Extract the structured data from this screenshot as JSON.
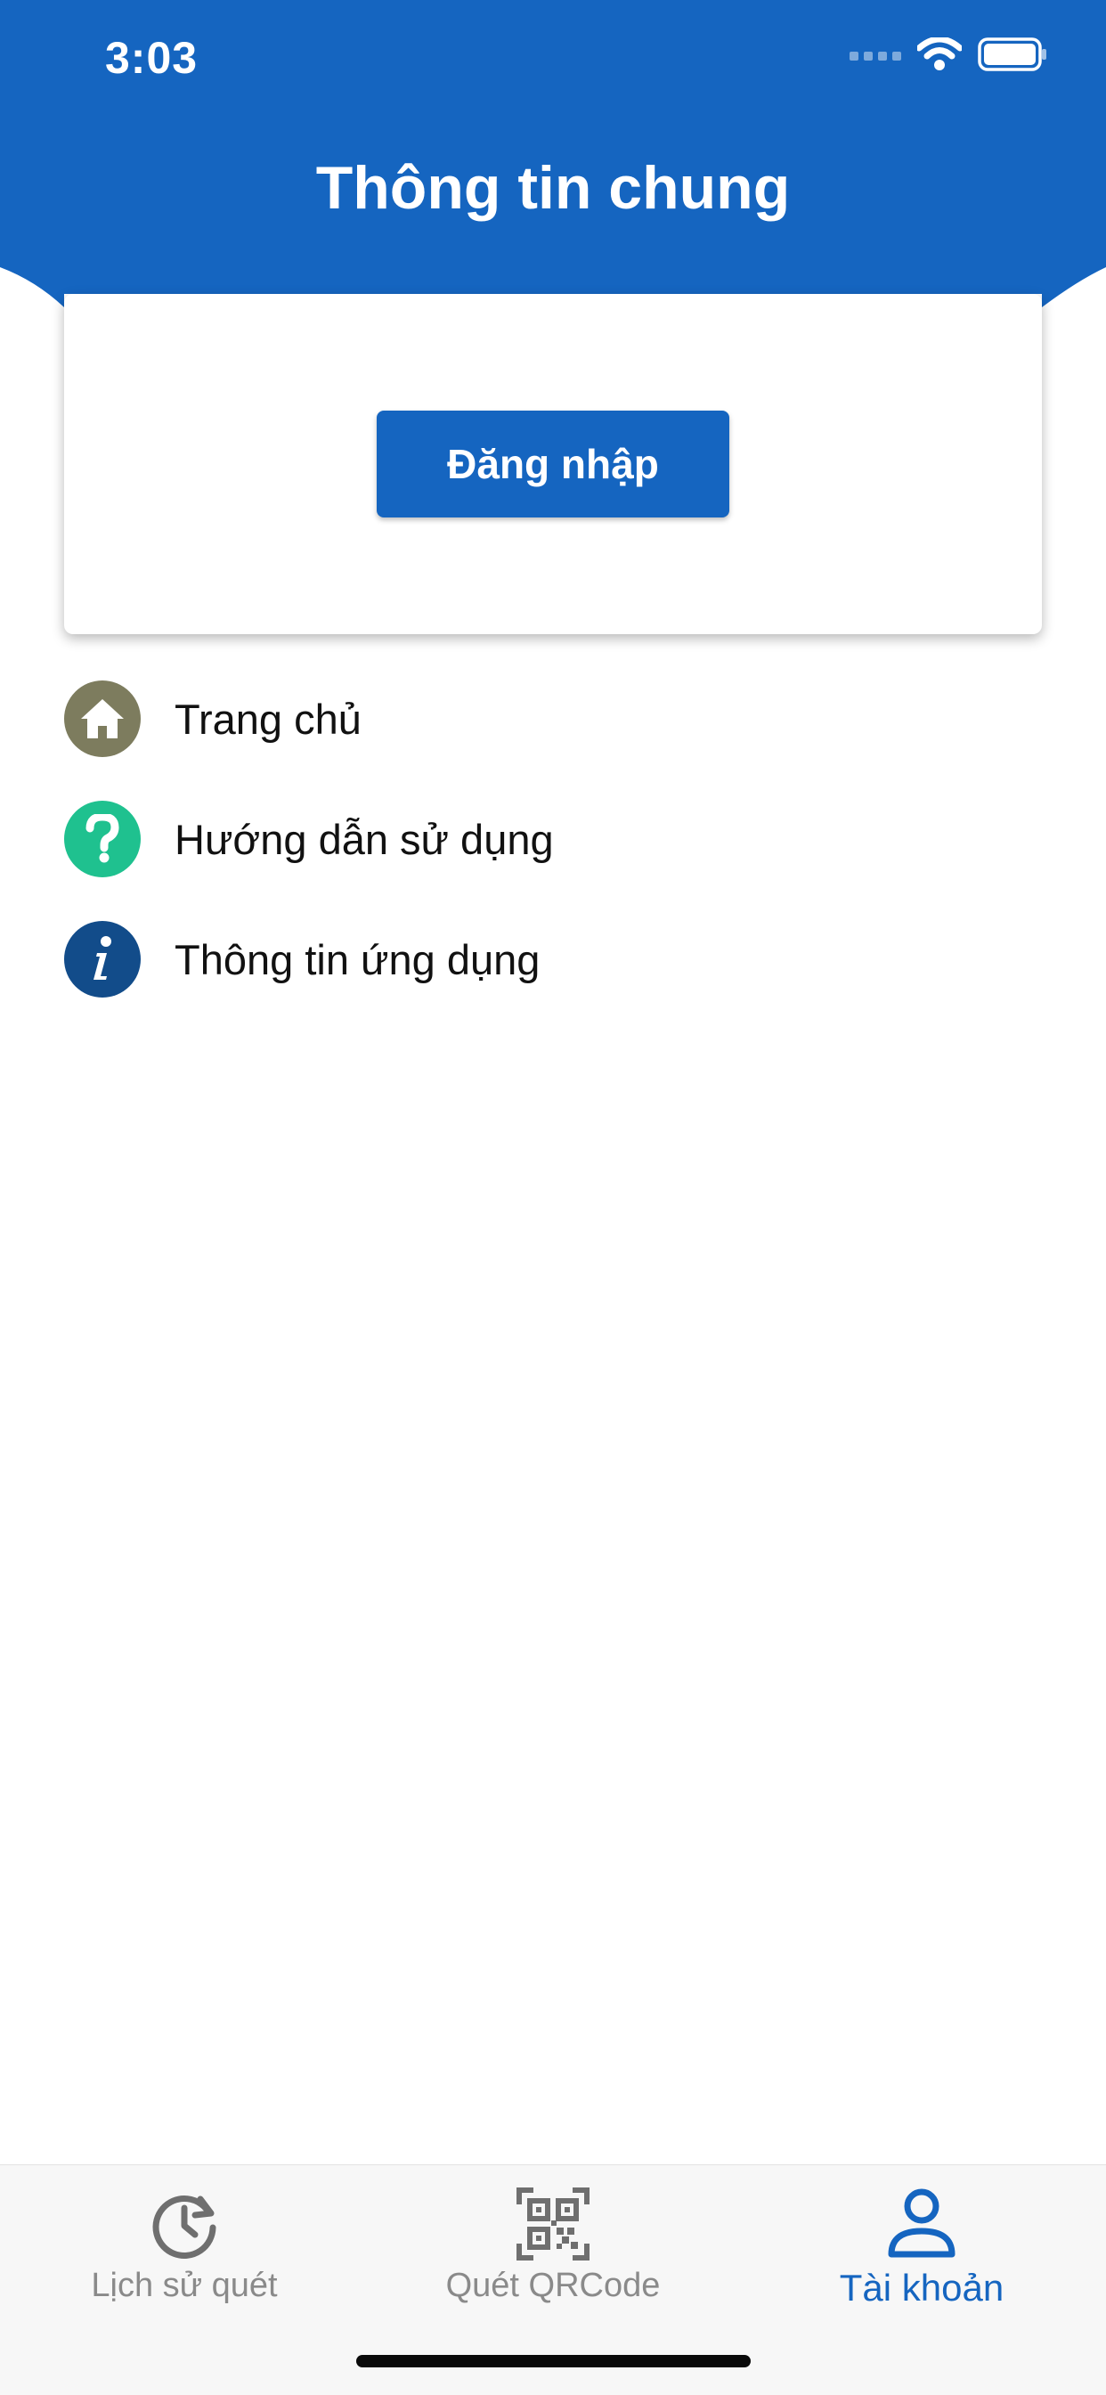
{
  "status_bar": {
    "time": "3:03"
  },
  "header": {
    "title": "Thông tin chung"
  },
  "login": {
    "button_label": "Đăng nhập"
  },
  "menu": {
    "items": [
      {
        "label": "Trang chủ",
        "icon": "home-icon",
        "color": "#7d7c5e"
      },
      {
        "label": "Hướng dẫn sử dụng",
        "icon": "help-icon",
        "color": "#1fc18f"
      },
      {
        "label": "Thông tin ứng dụng",
        "icon": "info-icon",
        "color": "#124c8a"
      }
    ]
  },
  "tab_bar": {
    "tabs": [
      {
        "label": "Lịch sử quét",
        "icon": "history-clock-icon",
        "active": false
      },
      {
        "label": "Quét QRCode",
        "icon": "qr-code-icon",
        "active": false
      },
      {
        "label": "Tài khoản",
        "icon": "account-person-icon",
        "active": true
      }
    ]
  },
  "colors": {
    "primary": "#1565c0",
    "tab_inactive": "#8a8a8a",
    "background": "#ffffff"
  }
}
